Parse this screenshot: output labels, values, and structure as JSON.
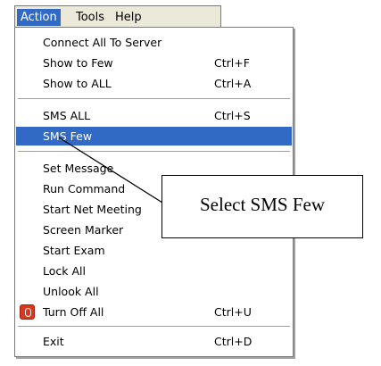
{
  "menubar": {
    "items": [
      "Action",
      "Tools",
      "Help"
    ],
    "active": "Action"
  },
  "menu": {
    "items": [
      {
        "label": "Connect All To Server",
        "shortcut": ""
      },
      {
        "label": "Show to Few",
        "shortcut": "Ctrl+F"
      },
      {
        "label": "Show to ALL",
        "shortcut": "Ctrl+A"
      },
      {
        "label": "SMS ALL",
        "shortcut": "Ctrl+S"
      },
      {
        "label": "SMS Few",
        "shortcut": ""
      },
      {
        "label": "Set Message",
        "shortcut": ""
      },
      {
        "label": "Run Command",
        "shortcut": ""
      },
      {
        "label": "Start Net Meeting",
        "shortcut": ""
      },
      {
        "label": "Screen Marker",
        "shortcut": ""
      },
      {
        "label": "Start Exam",
        "shortcut": ""
      },
      {
        "label": "Lock All",
        "shortcut": ""
      },
      {
        "label": "Unlook  All",
        "shortcut": ""
      },
      {
        "label": "Turn Off All",
        "shortcut": "Ctrl+U"
      },
      {
        "label": "Exit",
        "shortcut": "Ctrl+D"
      }
    ],
    "highlighted": "SMS Few",
    "highlight_color": "#316ac5"
  },
  "callout": {
    "text": "Select SMS Few"
  }
}
